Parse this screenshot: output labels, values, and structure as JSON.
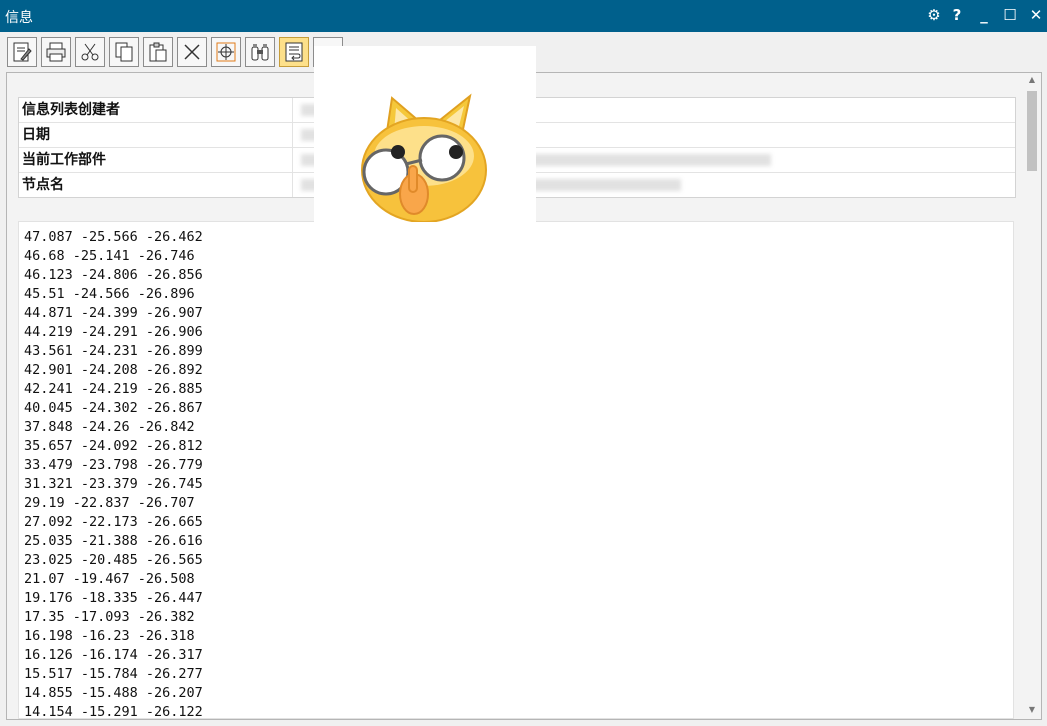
{
  "window": {
    "title": "信息"
  },
  "title_controls": [
    {
      "name": "settings-icon",
      "glyph": "⚙"
    },
    {
      "name": "help-icon",
      "glyph": "?"
    },
    {
      "name": "minimize-icon",
      "glyph": "_"
    },
    {
      "name": "maximize-icon",
      "glyph": "☐"
    },
    {
      "name": "close-icon",
      "glyph": "✕"
    }
  ],
  "toolbar": {
    "buttons": [
      {
        "name": "save-icon"
      },
      {
        "name": "print-icon"
      },
      {
        "name": "cut-icon"
      },
      {
        "name": "copy-icon"
      },
      {
        "name": "paste-icon"
      },
      {
        "name": "delete-icon"
      },
      {
        "name": "crosshair-icon"
      },
      {
        "name": "find-icon"
      },
      {
        "name": "wrap-text-icon",
        "active": true
      },
      {
        "name": "blank-icon"
      }
    ]
  },
  "properties": [
    {
      "label": "信息列表创建者"
    },
    {
      "label": "日期"
    },
    {
      "label": "当前工作部件"
    },
    {
      "label": "节点名"
    }
  ],
  "output_lines": [
    "47.087 -25.566 -26.462",
    "46.68 -25.141 -26.746",
    "46.123 -24.806 -26.856",
    "45.51 -24.566 -26.896",
    "44.871 -24.399 -26.907",
    "44.219 -24.291 -26.906",
    "43.561 -24.231 -26.899",
    "42.901 -24.208 -26.892",
    "42.241 -24.219 -26.885",
    "40.045 -24.302 -26.867",
    "37.848 -24.26 -26.842",
    "35.657 -24.092 -26.812",
    "33.479 -23.798 -26.779",
    "31.321 -23.379 -26.745",
    "29.19 -22.837 -26.707",
    "27.092 -22.173 -26.665",
    "25.035 -21.388 -26.616",
    "23.025 -20.485 -26.565",
    "21.07 -19.467 -26.508",
    "19.176 -18.335 -26.447",
    "17.35 -17.093 -26.382",
    "16.198 -16.23 -26.318",
    "16.126 -16.174 -26.317",
    "15.517 -15.784 -26.277",
    "14.855 -15.488 -26.207",
    "14.154 -15.291 -26.122"
  ]
}
